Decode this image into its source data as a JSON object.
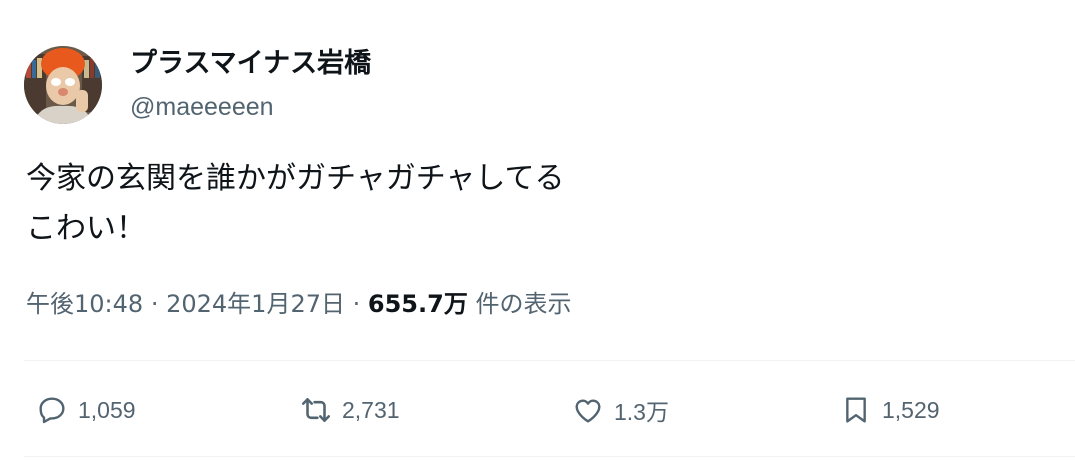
{
  "user": {
    "display_name": "プラスマイナス岩橋",
    "handle": "@maeeeeen"
  },
  "tweet": {
    "lines": [
      "今家の玄関を誰かがガチャガチャしてる",
      "こわい！"
    ]
  },
  "meta": {
    "time": "午後10:48",
    "separator": "·",
    "date": "2024年1月27日",
    "views_count": "655.7万",
    "views_label": "件の表示"
  },
  "actions": {
    "replies": "1,059",
    "retweets": "2,731",
    "likes": "1.3万",
    "bookmarks": "1,529"
  },
  "colors": {
    "text": "#0f1419",
    "secondary": "#536471",
    "divider": "#eff3f4"
  },
  "icons": [
    "reply-icon",
    "retweet-icon",
    "like-icon",
    "bookmark-icon"
  ]
}
